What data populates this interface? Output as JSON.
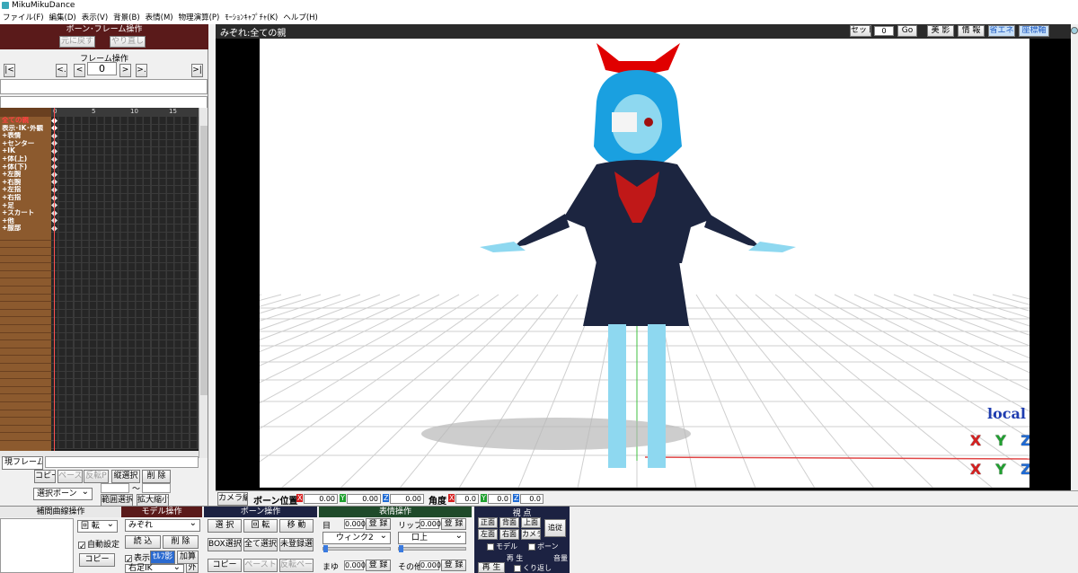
{
  "window": {
    "title": "MikuMikuDance"
  },
  "menu": [
    "ファイル(F)",
    "編集(D)",
    "表示(V)",
    "背景(B)",
    "表情(M)",
    "物理演算(P)",
    "ﾓｰｼｮﾝｷｬﾌﾟﾁｬ(K)",
    "ヘルプ(H)"
  ],
  "bone_frame": {
    "title": "ボーン･フレーム操作",
    "undo": "元に戻す",
    "redo": "やり直し"
  },
  "frame_op": {
    "title": "フレーム操作",
    "first": "|<",
    "prev_key": "<.",
    "prev": "<",
    "frame": "0",
    "next": ">",
    "next_key": ">.",
    "last": ">|"
  },
  "timeline": {
    "ticks": [
      "0",
      "5",
      "10",
      "15"
    ],
    "bones": [
      "全ての親",
      "表示･IK･外観",
      "+表情",
      "+センター",
      "+IK",
      "+体(上)",
      "+体(下)",
      "+左腕",
      "+右腕",
      "+左指",
      "+右指",
      "+足",
      "+スカート",
      "+他",
      "+服部"
    ]
  },
  "left_bottom": {
    "current_frame": "現フレーム",
    "copy": "コピー",
    "paste": "ペースト",
    "reverse_paste": "反転P",
    "vertical_select": "縦選択",
    "delete": "削 除",
    "selected_bone": "選択ボーン",
    "range_select": "範囲選択",
    "expand": "拡大縮小",
    "tilde": "〜"
  },
  "viewport": {
    "title": "みぞれ:全ての親",
    "set": "セット",
    "set_value": "0",
    "go": "Go",
    "beauty": "美 影",
    "info": "情 報",
    "energy": "省エネ",
    "axis": "座標軸",
    "local": "local",
    "axes": [
      "X",
      "Y",
      "Z"
    ]
  },
  "statusbar": {
    "camera_edit": "カメラ編",
    "bone_pos": "ボーン位置",
    "pos": [
      "0.00",
      "0.00",
      "0.00"
    ],
    "angle": "角度",
    "ang": [
      "0.0",
      "0.0",
      "0.0"
    ]
  },
  "interp": {
    "title": "補間曲線操作",
    "rotate": "回 転",
    "auto": "自動設定",
    "copy": "コピー"
  },
  "model": {
    "title": "モデル操作",
    "name": "みぞれ",
    "load": "読 込",
    "delete": "削 除",
    "show": "表示",
    "alpha": "ｾﾙﾌ影",
    "add": "加算",
    "bone": "右足IK",
    "outer": "外"
  },
  "bone_op": {
    "title": "ボーン操作",
    "select": "選 択",
    "rotate": "回 転",
    "move": "移 動",
    "box": "BOX選択",
    "all": "全て選択",
    "unreg": "未登録選",
    "copy": "コピー",
    "paste": "ペースト",
    "rev": "反転ペースト"
  },
  "morph": {
    "title": "表情操作",
    "eye": "目",
    "eye_val": "0.000",
    "register": "登 録",
    "lip": "リップ",
    "lip_val": "0.000",
    "eye_sel": "ウィンク2",
    "lip_sel": "口上",
    "brow": "まゆ",
    "brow_val": "0.000",
    "other": "その他",
    "other_val": "0.000"
  },
  "view": {
    "title": "視 点",
    "front": "正面",
    "back": "背面",
    "top": "上面",
    "follow": "追従",
    "left": "左面",
    "right": "右面",
    "camera": "カメラ",
    "model": "モデル",
    "bone": "ボーン"
  },
  "play": {
    "title": "再 生",
    "play": "再 生",
    "repeat": "くり返し",
    "volume": "音量"
  },
  "colors": {
    "maroon": "#5a1a1a",
    "navy": "#1c2242",
    "green": "#1f4a2a",
    "x": "#d62020",
    "y": "#20a030",
    "z": "#1e6ad4"
  }
}
